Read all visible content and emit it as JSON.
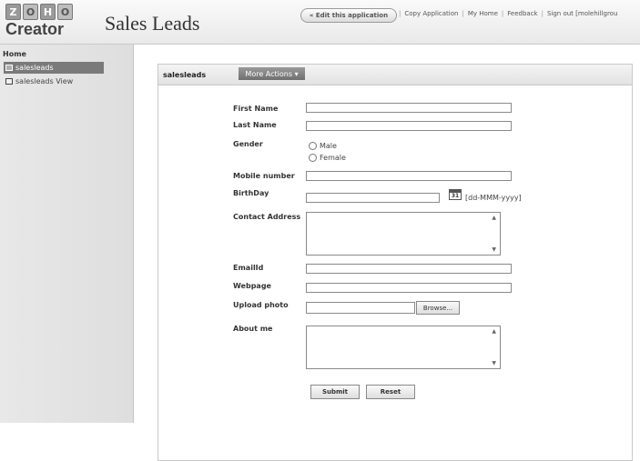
{
  "logo": {
    "letters": [
      "Z",
      "O",
      "H",
      "O"
    ],
    "product": "Creator"
  },
  "app": {
    "title": "Sales Leads"
  },
  "header": {
    "edit_button": "« Edit this application",
    "links": [
      "Copy Application",
      "My Home",
      "Feedback",
      "Sign out [molehillgrou"
    ]
  },
  "sidebar": {
    "home": "Home",
    "items": [
      {
        "label": "salesleads"
      },
      {
        "label": "salesleads View"
      }
    ]
  },
  "form": {
    "name": "salesleads",
    "more_actions": "More Actions ▾",
    "labels": {
      "first_name": "First Name",
      "last_name": "Last Name",
      "gender": "Gender",
      "mobile": "Mobile number",
      "birthday": "BirthDay",
      "address": "Contact Address",
      "email": "EmailId",
      "webpage": "Webpage",
      "photo": "Upload photo",
      "about": "About me"
    },
    "gender_options": [
      "Male",
      "Female"
    ],
    "calendar_day": "31",
    "date_hint": "[dd-MMM-yyyy]",
    "browse": "Browse...",
    "submit": "Submit",
    "reset": "Reset"
  }
}
